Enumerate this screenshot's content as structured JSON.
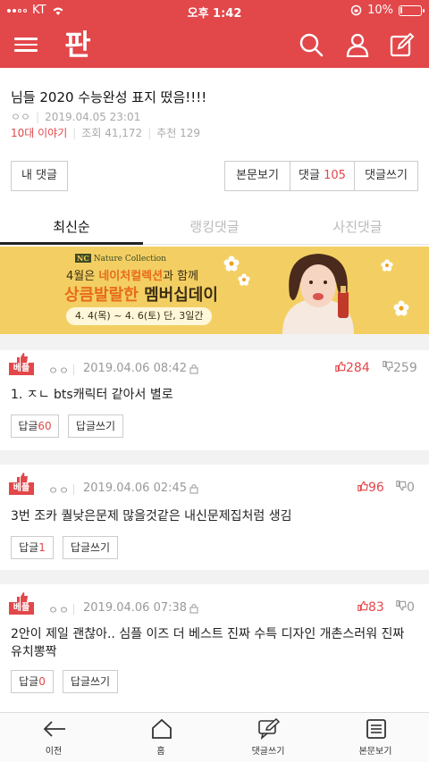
{
  "status": {
    "carrier": "KT",
    "time": "오후 1:42",
    "battery": "10%",
    "battery_level": 0.1
  },
  "header": {
    "logo": "판"
  },
  "post": {
    "title": "님들 2020 수능완성 표지 떴음!!!!",
    "author": "ㅇㅇ",
    "date": "2019.04.05 23:01",
    "category": "10대 이야기",
    "views": "조회 41,172",
    "recommend": "추천 129"
  },
  "buttons": {
    "my_comment": "내 댓글",
    "view_post": "본문보기",
    "comment_label": "댓글",
    "comment_count": "105",
    "write_comment": "댓글쓰기"
  },
  "tabs": [
    "최신순",
    "랭킹댓글",
    "사진댓글"
  ],
  "banner": {
    "brand": "Nature Collection",
    "line1_prefix": "4월은 ",
    "line1_highlight": "네이처컬렉션",
    "line1_suffix": "과 함께",
    "line2_orange": "상큼발랄한 ",
    "line2_dark": "멤버십데이",
    "period": "4. 4(목) ~ 4. 6(토) 단, 3일간"
  },
  "comments": [
    {
      "badge": "베플",
      "author": "ㅇㅇ",
      "date": "2019.04.06 08:42",
      "up": "284",
      "down": "259",
      "text": "1. ㅈㄴ bts캐릭터 같아서 별로",
      "reply_label": "답글",
      "reply_count": "60",
      "write_reply": "답글쓰기"
    },
    {
      "badge": "베플",
      "author": "ㅇㅇ",
      "date": "2019.04.06 02:45",
      "up": "96",
      "down": "0",
      "text": "3번 조카 퀄낮은문제 많을것같은 내신문제집처럼 생김",
      "reply_label": "답글",
      "reply_count": "1",
      "write_reply": "답글쓰기"
    },
    {
      "badge": "베플",
      "author": "ㅇㅇ",
      "date": "2019.04.06 07:38",
      "up": "83",
      "down": "0",
      "text": "2안이 제일 괜찮아.. 심플 이즈 더 베스트 진짜 수특 디자인 개촌스러워 진짜 유치뽕짝",
      "reply_label": "답글",
      "reply_count": "0",
      "write_reply": "답글쓰기"
    }
  ],
  "bottom_nav": [
    "이전",
    "홈",
    "댓글쓰기",
    "본문보기"
  ],
  "colors": {
    "brand": "#e2474a",
    "banner_bg": "#f3cf63",
    "accent_orange": "#e86b1a"
  }
}
